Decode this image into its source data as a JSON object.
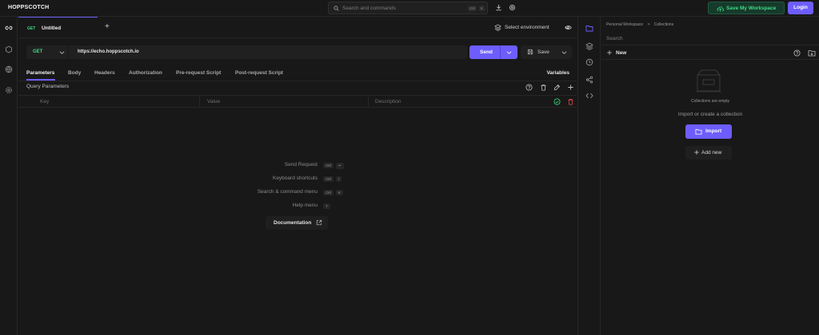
{
  "app": {
    "brand": "HOPPSCOTCH"
  },
  "topbar": {
    "search_placeholder": "Search and commands",
    "search_kbd_ctrl": "Ctrl",
    "search_kbd_key": "K",
    "save_workspace_label": "Save My Workspace",
    "login_label": "Login"
  },
  "tabs": [
    {
      "method": "GET",
      "name": "Untitled"
    }
  ],
  "add_tab_label": "+",
  "environment": {
    "label": "Select environment"
  },
  "request": {
    "method": "GET",
    "url": "https://echo.hoppscotch.io",
    "send_label": "Send",
    "save_label": "Save"
  },
  "subtabs": [
    {
      "label": "Parameters",
      "active": true
    },
    {
      "label": "Body"
    },
    {
      "label": "Headers"
    },
    {
      "label": "Authorization"
    },
    {
      "label": "Pre-request Script"
    },
    {
      "label": "Post-request Script"
    }
  ],
  "variables_label": "Variables",
  "query_params": {
    "title": "Query Parameters",
    "columns": {
      "key": "Key",
      "value": "Value",
      "description": "Description"
    }
  },
  "shortcuts": [
    {
      "label": "Send Request",
      "keys": [
        "Ctrl",
        "↵"
      ]
    },
    {
      "label": "Keyboard shortcuts",
      "keys": [
        "Ctrl",
        "/"
      ]
    },
    {
      "label": "Search & command menu",
      "keys": [
        "Ctrl",
        "K"
      ]
    },
    {
      "label": "Help menu",
      "keys": [
        "?"
      ]
    }
  ],
  "documentation_label": "Documentation",
  "collections": {
    "breadcrumb_workspace": "Personal Workspace",
    "breadcrumb_sep": ">",
    "breadcrumb_page": "Collections",
    "search_placeholder": "Search",
    "new_label": "New",
    "empty_text": "Collections are empty",
    "import_prompt": "Import or create a collection",
    "import_label": "Import",
    "add_new_label": "Add new"
  },
  "colors": {
    "accent": "#6d5dfc",
    "method_get": "#3ddc84",
    "background": "#181818",
    "danger": "#e5484d"
  }
}
